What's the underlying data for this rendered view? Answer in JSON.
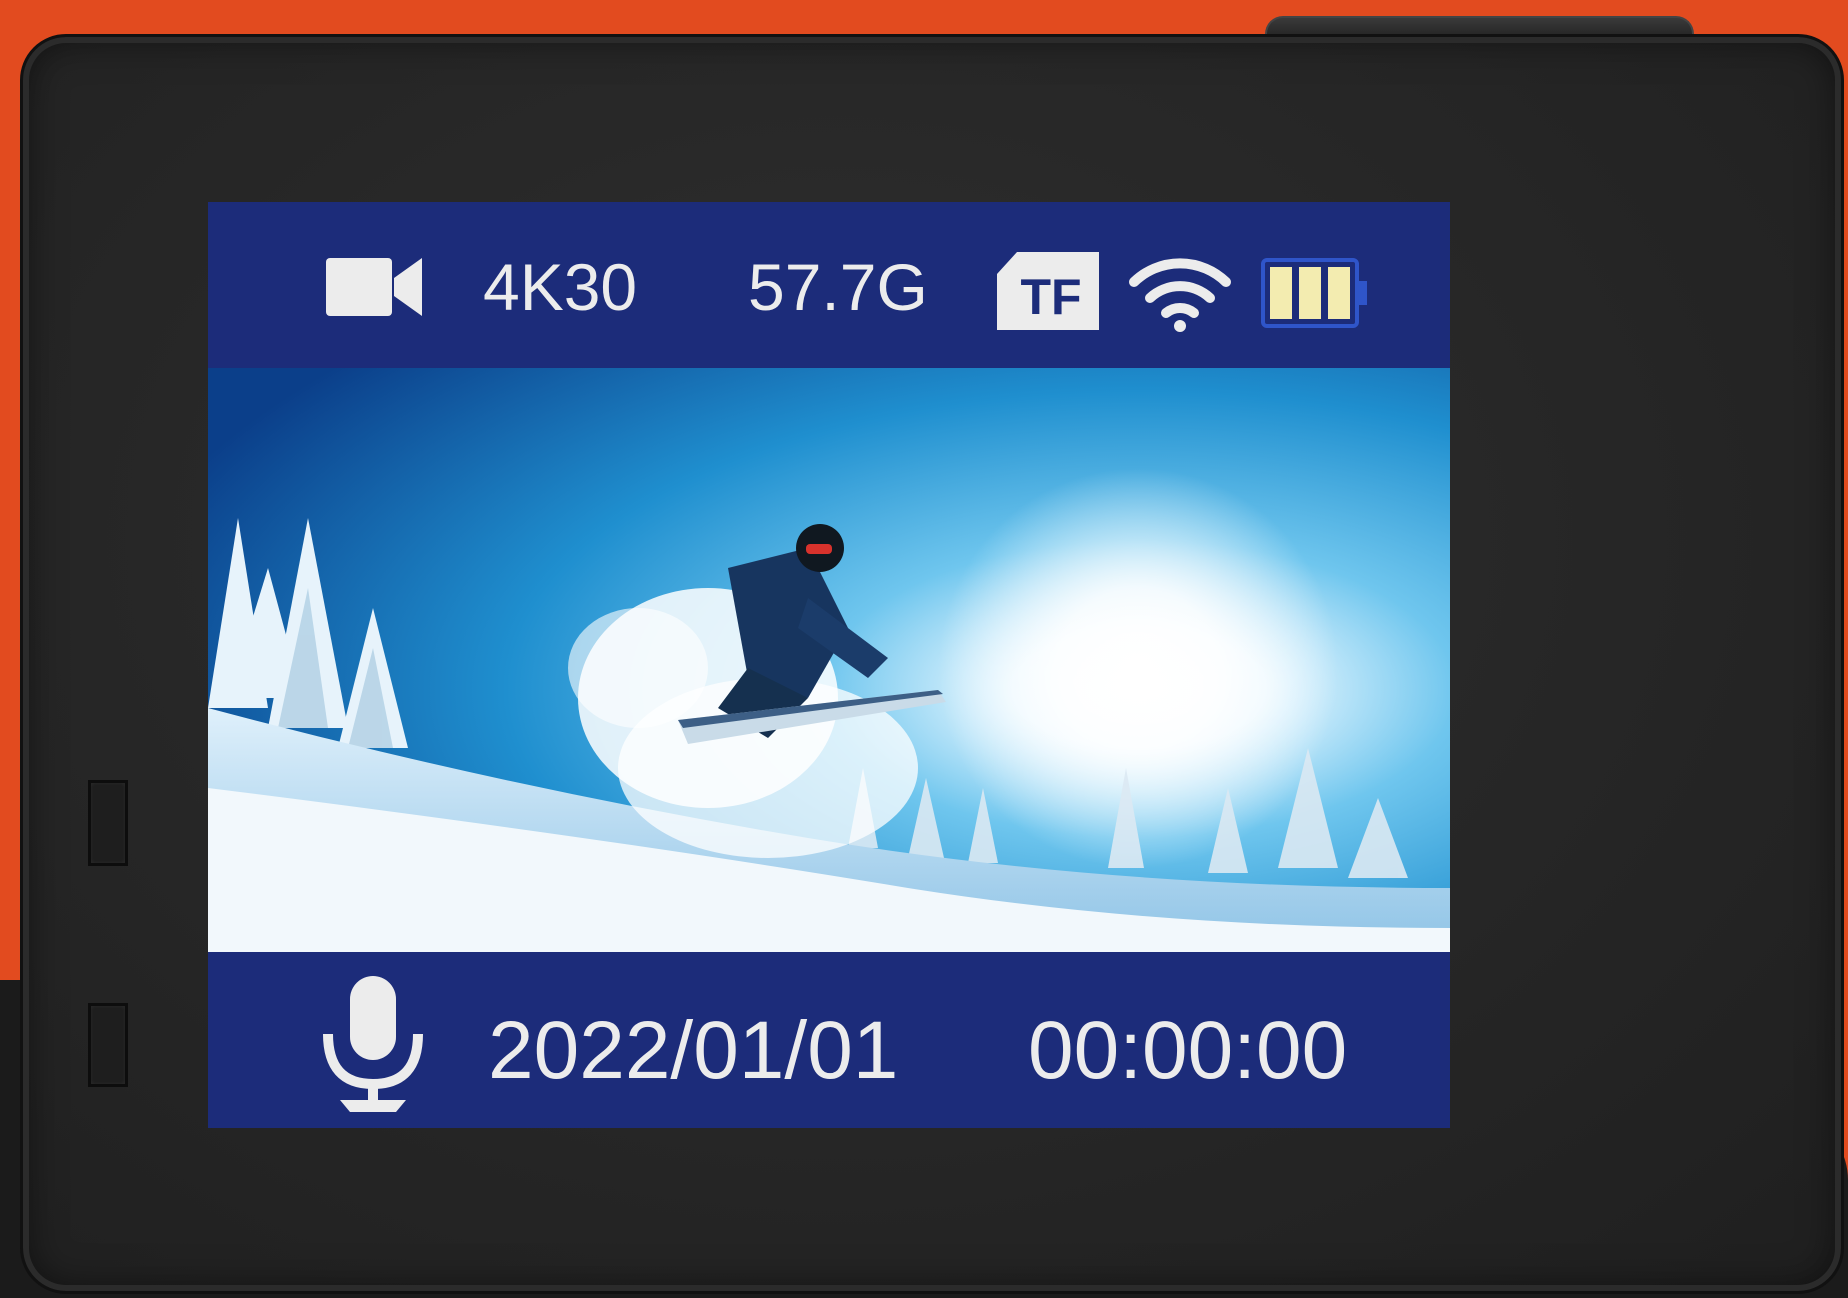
{
  "status_top": {
    "mode_icon": "video-camera-icon",
    "resolution": "4K30",
    "storage_remaining": "57.7G",
    "storage_icon": "tf-card-icon",
    "storage_icon_label": "TF",
    "wifi_icon": "wifi-icon",
    "battery_icon": "battery-icon",
    "battery_level_bars": 3,
    "battery_level_max": 3
  },
  "status_bottom": {
    "audio_icon": "microphone-icon",
    "date": "2022/01/01",
    "time": "00:00:00"
  },
  "colors": {
    "status_bar_blue": "#1c2c7a",
    "text": "#ececec",
    "battery_fill": "#f3ecb0",
    "backdrop_orange": "#e24b1f",
    "camera_body": "#262626"
  }
}
